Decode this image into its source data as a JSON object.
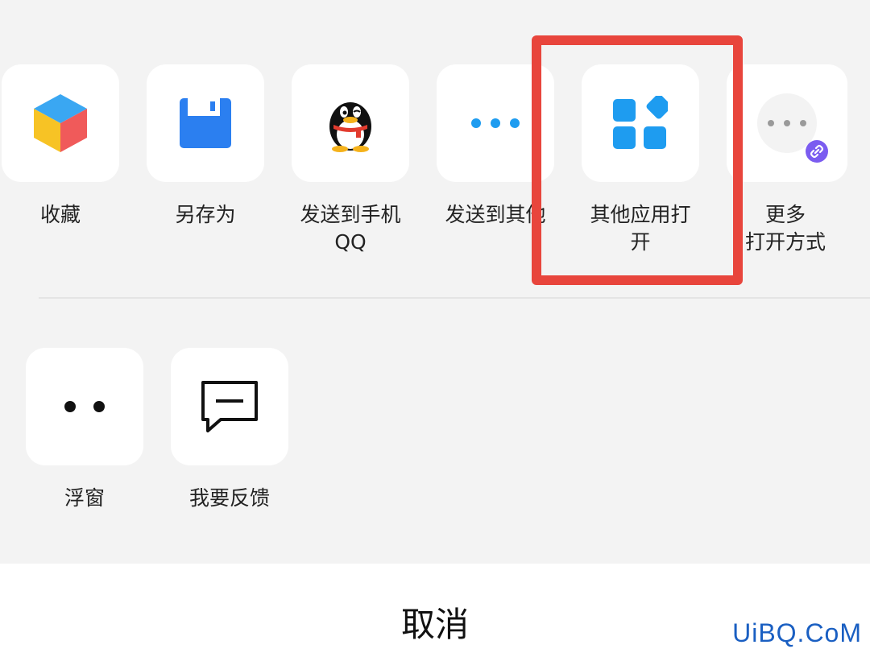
{
  "share_sheet": {
    "row1": [
      {
        "label": "收藏",
        "icon": "cube-icon"
      },
      {
        "label": "另存为",
        "icon": "save-icon"
      },
      {
        "label": "发送到手机\nQQ",
        "icon": "qq-penguin-icon"
      },
      {
        "label": "发送到其他",
        "icon": "more-dots-icon"
      },
      {
        "label": "其他应用打\n开",
        "icon": "apps-grid-icon"
      },
      {
        "label": "更多\n打开方式",
        "icon": "mini-program-icon"
      }
    ],
    "row2": [
      {
        "label": "浮窗",
        "icon": "float-window-icon"
      },
      {
        "label": "我要反馈",
        "icon": "feedback-icon"
      }
    ]
  },
  "cancel_label": "取消",
  "watermark": "UiBQ.CoM",
  "colors": {
    "accent_blue": "#1e9cf0",
    "highlight_red": "#e8453c",
    "background": "#f3f3f3"
  }
}
